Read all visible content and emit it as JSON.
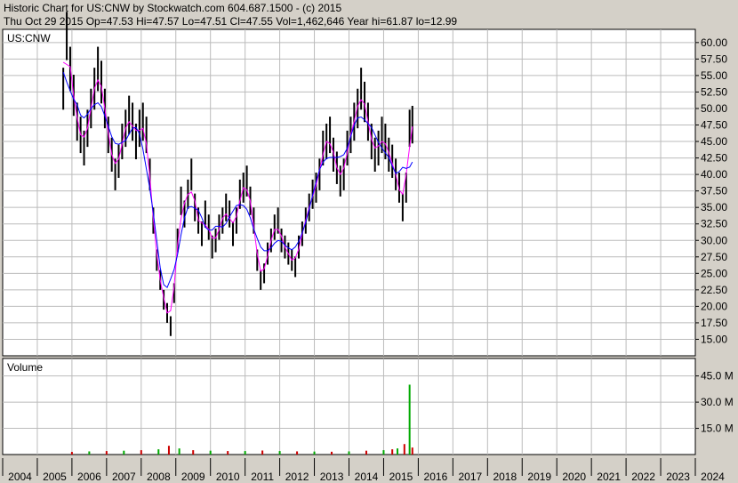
{
  "header": {
    "line1": "Historic Chart for US:CNW by Stockwatch.com 604.687.1500 - (c) 2015",
    "line2": "Thu Oct 29 2015    Op=47.53    Hi=47.57    Lo=47.51    Cl=47.55    Vol=1,462,646    Year hi=61.87    lo=12.99"
  },
  "colors": {
    "background": "#d4d0c8",
    "plot": "#ffffff",
    "price_bars": "#000000",
    "ma_short": "#ff00ff",
    "ma_long": "#0000ff",
    "volume_up": "#00aa00",
    "volume_down": "#cc0000"
  },
  "chart_data": [
    {
      "type": "line",
      "title": "US:CNW",
      "ylim": [
        12.5,
        62
      ],
      "y_ticks": [
        15,
        17.5,
        20,
        22.5,
        25,
        27.5,
        30,
        32.5,
        35,
        37.5,
        40,
        42.5,
        45,
        47.5,
        50,
        52.5,
        55,
        57.5,
        60
      ],
      "y_tick_labels": [
        "15.00",
        "17.50",
        "20.00",
        "22.50",
        "25.00",
        "27.50",
        "30.00",
        "32.50",
        "35.00",
        "37.50",
        "40.00",
        "42.50",
        "45.00",
        "47.50",
        "50.00",
        "52.50",
        "55.00",
        "57.50",
        "60.00"
      ],
      "x_labels": [
        "2004",
        "2005",
        "2006",
        "2007",
        "2008",
        "2009",
        "2010",
        "2011",
        "2012",
        "2013",
        "2014",
        "2015",
        "2016",
        "2017",
        "2018",
        "2019",
        "2020",
        "2021",
        "2022",
        "2023",
        "2024"
      ],
      "xlim": [
        2004,
        2024
      ],
      "grid": true,
      "series": [
        {
          "x": [
            2005.75,
            2005.85,
            2005.95,
            2006.05,
            2006.15,
            2006.25,
            2006.35,
            2006.45,
            2006.55,
            2006.65,
            2006.75,
            2006.85,
            2006.95,
            2007.05,
            2007.15,
            2007.25,
            2007.35,
            2007.45,
            2007.55,
            2007.65,
            2007.75,
            2007.85,
            2007.95,
            2008.05,
            2008.15,
            2008.25,
            2008.35,
            2008.45,
            2008.55,
            2008.65,
            2008.75,
            2008.85,
            2008.95,
            2009.05,
            2009.15,
            2009.25,
            2009.35,
            2009.45,
            2009.55,
            2009.65,
            2009.75,
            2009.85,
            2009.95,
            2010.05,
            2010.15,
            2010.25,
            2010.35,
            2010.45,
            2010.55,
            2010.65,
            2010.75,
            2010.85,
            2010.95,
            2011.05,
            2011.15,
            2011.25,
            2011.35,
            2011.45,
            2011.55,
            2011.65,
            2011.75,
            2011.85,
            2011.95,
            2012.05,
            2012.15,
            2012.25,
            2012.35,
            2012.45,
            2012.55,
            2012.65,
            2012.75,
            2012.85,
            2012.95,
            2013.05,
            2013.15,
            2013.25,
            2013.35,
            2013.45,
            2013.55,
            2013.65,
            2013.75,
            2013.85,
            2013.95,
            2014.05,
            2014.15,
            2014.25,
            2014.35,
            2014.45,
            2014.55,
            2014.65,
            2014.75,
            2014.85,
            2014.95,
            2015.05,
            2015.15,
            2015.25,
            2015.35,
            2015.45,
            2015.55,
            2015.65,
            2015.75,
            2015.83
          ],
          "values": [
            53,
            61,
            56,
            52,
            48,
            46,
            44,
            47,
            50,
            53,
            56,
            54,
            50,
            46,
            43,
            40,
            42,
            45,
            47,
            49,
            48,
            45,
            47,
            48,
            46,
            40,
            33,
            27,
            24,
            21,
            19,
            17,
            22,
            30,
            36,
            34,
            37,
            40,
            35,
            33,
            31,
            34,
            32,
            29,
            30,
            32,
            33,
            35,
            34,
            31,
            33,
            37,
            38,
            39,
            36,
            33,
            27,
            24,
            25,
            28,
            30,
            32,
            33,
            30,
            29,
            28,
            27,
            26,
            29,
            31,
            33,
            35,
            37,
            38,
            40,
            44,
            45,
            46,
            43,
            41,
            39,
            40,
            44,
            46,
            48,
            50,
            53,
            51,
            48,
            45,
            43,
            44,
            46,
            45,
            43,
            42,
            40,
            38,
            35,
            38,
            47,
            47.55
          ]
        }
      ]
    },
    {
      "type": "bar",
      "title": "Volume",
      "y_tick_labels": [
        "15.0 M",
        "30.0 M",
        "45.0 M"
      ],
      "y_ticks": [
        15,
        30,
        45
      ],
      "ylim": [
        0,
        55
      ],
      "x": [
        2006.0,
        2006.5,
        2007.0,
        2007.5,
        2008.0,
        2008.5,
        2008.8,
        2009.1,
        2009.5,
        2010.0,
        2010.5,
        2011.0,
        2011.5,
        2012.0,
        2012.5,
        2013.0,
        2013.5,
        2014.0,
        2014.5,
        2015.0,
        2015.25,
        2015.4,
        2015.6,
        2015.75,
        2015.83
      ],
      "values": [
        1.5,
        1.8,
        2.0,
        2.2,
        2.5,
        3.0,
        5.0,
        3.5,
        2.5,
        2.2,
        2.0,
        2.0,
        2.3,
        2.0,
        1.8,
        1.7,
        1.6,
        1.8,
        2.2,
        2.5,
        3.0,
        3.5,
        6.0,
        40.0,
        4.0
      ]
    }
  ]
}
